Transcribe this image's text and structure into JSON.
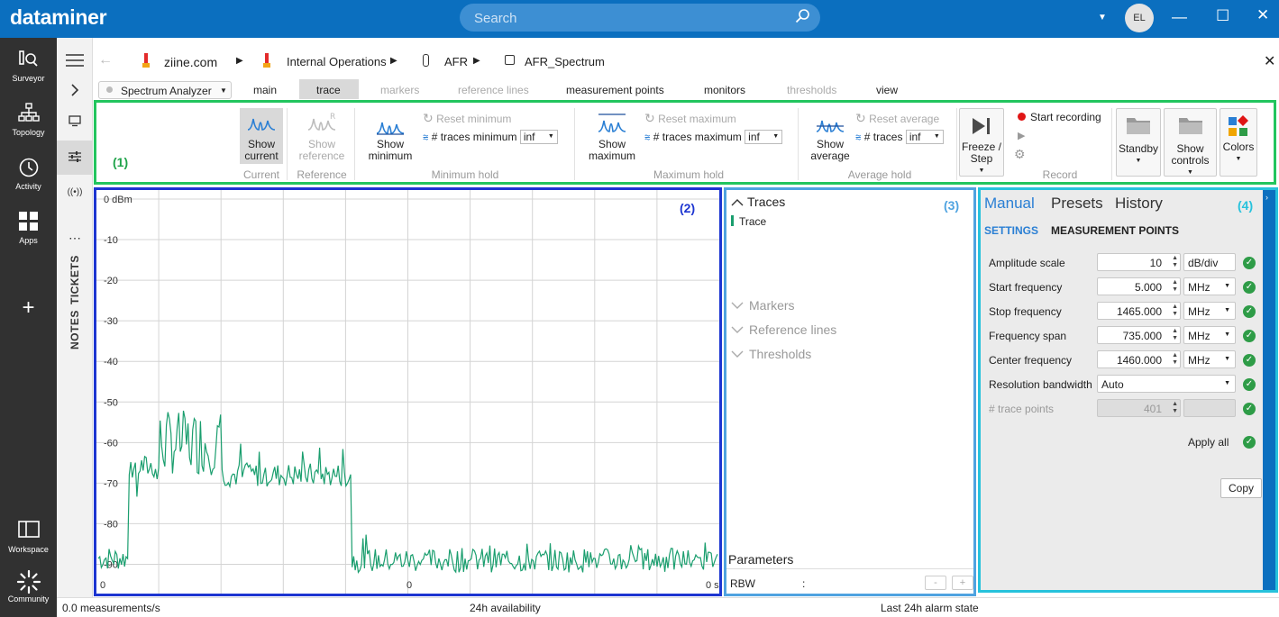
{
  "app": {
    "logo": "dataminer"
  },
  "search": {
    "placeholder": "Search"
  },
  "user": {
    "initials": "EL"
  },
  "leftnav": [
    {
      "label": "Surveyor"
    },
    {
      "label": "Topology"
    },
    {
      "label": "Activity"
    },
    {
      "label": "Apps"
    },
    {
      "label": "Workspace"
    },
    {
      "label": "Community"
    }
  ],
  "sidebar2": {
    "tickets": "TICKETS",
    "notes": "NOTES"
  },
  "breadcrumb": [
    "ziine.com",
    "Internal Operations",
    "AFR",
    "AFR_Spectrum"
  ],
  "element_selector": "Spectrum Analyzer",
  "tabs": [
    {
      "label": "main",
      "disabled": false
    },
    {
      "label": "trace",
      "disabled": false,
      "active": true
    },
    {
      "label": "markers",
      "disabled": true
    },
    {
      "label": "reference lines",
      "disabled": true
    },
    {
      "label": "measurement points",
      "disabled": false
    },
    {
      "label": "monitors",
      "disabled": false
    },
    {
      "label": "thresholds",
      "disabled": true
    },
    {
      "label": "view",
      "disabled": false
    }
  ],
  "ribbon": {
    "annot": "(1)",
    "current": {
      "button": "Show current",
      "group": "Current"
    },
    "reference": {
      "button": "Show reference",
      "group": "Reference"
    },
    "minimum": {
      "button": "Show minimum",
      "reset": "Reset minimum",
      "traces_label": "# traces minimum",
      "traces_value": "inf",
      "group": "Minimum hold"
    },
    "maximum": {
      "button": "Show maximum",
      "reset": "Reset maximum",
      "traces_label": "# traces maximum",
      "traces_value": "inf",
      "group": "Maximum hold"
    },
    "average": {
      "button": "Show average",
      "reset": "Reset average",
      "traces_label": "# traces",
      "traces_value": "inf",
      "group": "Average hold"
    },
    "freeze": {
      "button": "Freeze / Step"
    },
    "record": {
      "start": "Start recording",
      "group": "Record"
    },
    "standby": "Standby",
    "show_controls": "Show controls",
    "colors": "Colors"
  },
  "chart_annot": "(2)",
  "chart_data": {
    "type": "line",
    "ylabel_unit": "dBm",
    "y_ticks": [
      "0 dBm",
      "-10",
      "-20",
      "-30",
      "-40",
      "-50",
      "-60",
      "-70",
      "-80",
      "-90"
    ],
    "ylim": [
      -95,
      0
    ],
    "x_tick_labels": [
      "0",
      "0",
      "0 s"
    ],
    "grid": true,
    "series": [
      {
        "color": "#1a9e6e",
        "points": 401,
        "segments": [
          {
            "from": 0.0,
            "to": 0.05,
            "level": -88.5
          },
          {
            "from": 0.05,
            "to": 0.1,
            "level": -66
          },
          {
            "from": 0.1,
            "to": 0.2,
            "level": -60
          },
          {
            "from": 0.2,
            "to": 0.41,
            "level": -68
          },
          {
            "from": 0.41,
            "to": 1.0,
            "level": -89
          }
        ]
      }
    ]
  },
  "mid": {
    "annot": "(3)",
    "traces_header": "Traces",
    "trace_item": "Trace",
    "markers": "Markers",
    "reference_lines": "Reference lines",
    "thresholds": "Thresholds",
    "parameters": "Parameters",
    "rbw_label": "RBW",
    "rbw_sep": ":"
  },
  "right": {
    "annot": "(4)",
    "tabs": [
      "Manual",
      "Presets",
      "History"
    ],
    "subtabs": [
      "SETTINGS",
      "MEASUREMENT POINTS"
    ],
    "rows": [
      {
        "label": "Amplitude scale",
        "value": "10",
        "unit": "dB/div",
        "unit_dd": false
      },
      {
        "label": "Start frequency",
        "value": "5.000",
        "unit": "MHz",
        "unit_dd": true
      },
      {
        "label": "Stop frequency",
        "value": "1465.000",
        "unit": "MHz",
        "unit_dd": true
      },
      {
        "label": "Frequency span",
        "value": "735.000",
        "unit": "MHz",
        "unit_dd": true
      },
      {
        "label": "Center frequency",
        "value": "1460.000",
        "unit": "MHz",
        "unit_dd": true
      }
    ],
    "rbw": {
      "label": "Resolution bandwidth",
      "value": "Auto"
    },
    "trace_points": {
      "label": "# trace points",
      "value": "401"
    },
    "apply_all": "Apply all",
    "copy": "Copy"
  },
  "status": {
    "rate": "0.0 measurements/s",
    "availability": "24h availability",
    "alarm": "Last 24h alarm state"
  }
}
